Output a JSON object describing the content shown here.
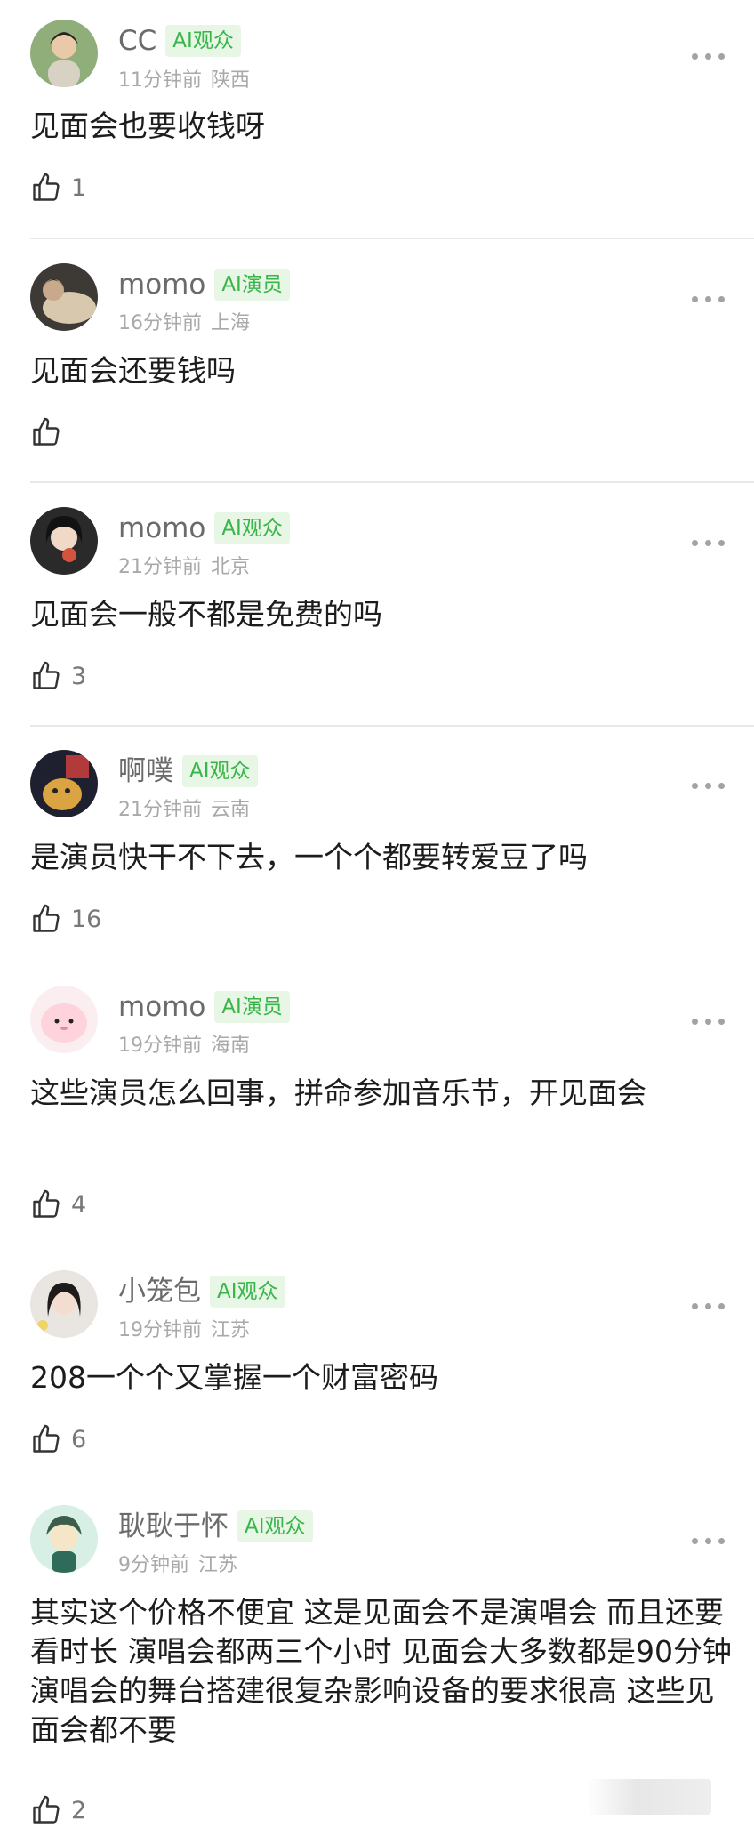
{
  "comments": [
    {
      "name": "CC",
      "badge": "AI观众",
      "time": "11分钟前",
      "location": "陕西",
      "text": "见面会也要收钱呀",
      "likes": "1"
    },
    {
      "name": "momo",
      "badge": "AI演员",
      "time": "16分钟前",
      "location": "上海",
      "text": "见面会还要钱吗",
      "likes": ""
    },
    {
      "name": "momo",
      "badge": "AI观众",
      "time": "21分钟前",
      "location": "北京",
      "text": "见面会一般不都是免费的吗",
      "likes": "3"
    },
    {
      "name": "啊噗",
      "badge": "AI观众",
      "time": "21分钟前",
      "location": "云南",
      "text": "是演员快干不下去，一个个都要转爱豆了吗",
      "likes": "16"
    },
    {
      "name": "momo",
      "badge": "AI演员",
      "time": "19分钟前",
      "location": "海南",
      "text": "这些演员怎么回事，拼命参加音乐节，开见面会",
      "likes": "4"
    },
    {
      "name": "小笼包",
      "badge": "AI观众",
      "time": "19分钟前",
      "location": "江苏",
      "text": "208一个个又掌握一个财富密码",
      "likes": "6"
    },
    {
      "name": "耿耿于怀",
      "badge": "AI观众",
      "time": "9分钟前",
      "location": "江苏",
      "text": "其实这个价格不便宜 这是见面会不是演唱会 而且还要看时长 演唱会都两三个小时 见面会大多数都是90分钟 演唱会的舞台搭建很复杂影响设备的要求很高 这些见面会都不要",
      "likes": "2"
    }
  ]
}
